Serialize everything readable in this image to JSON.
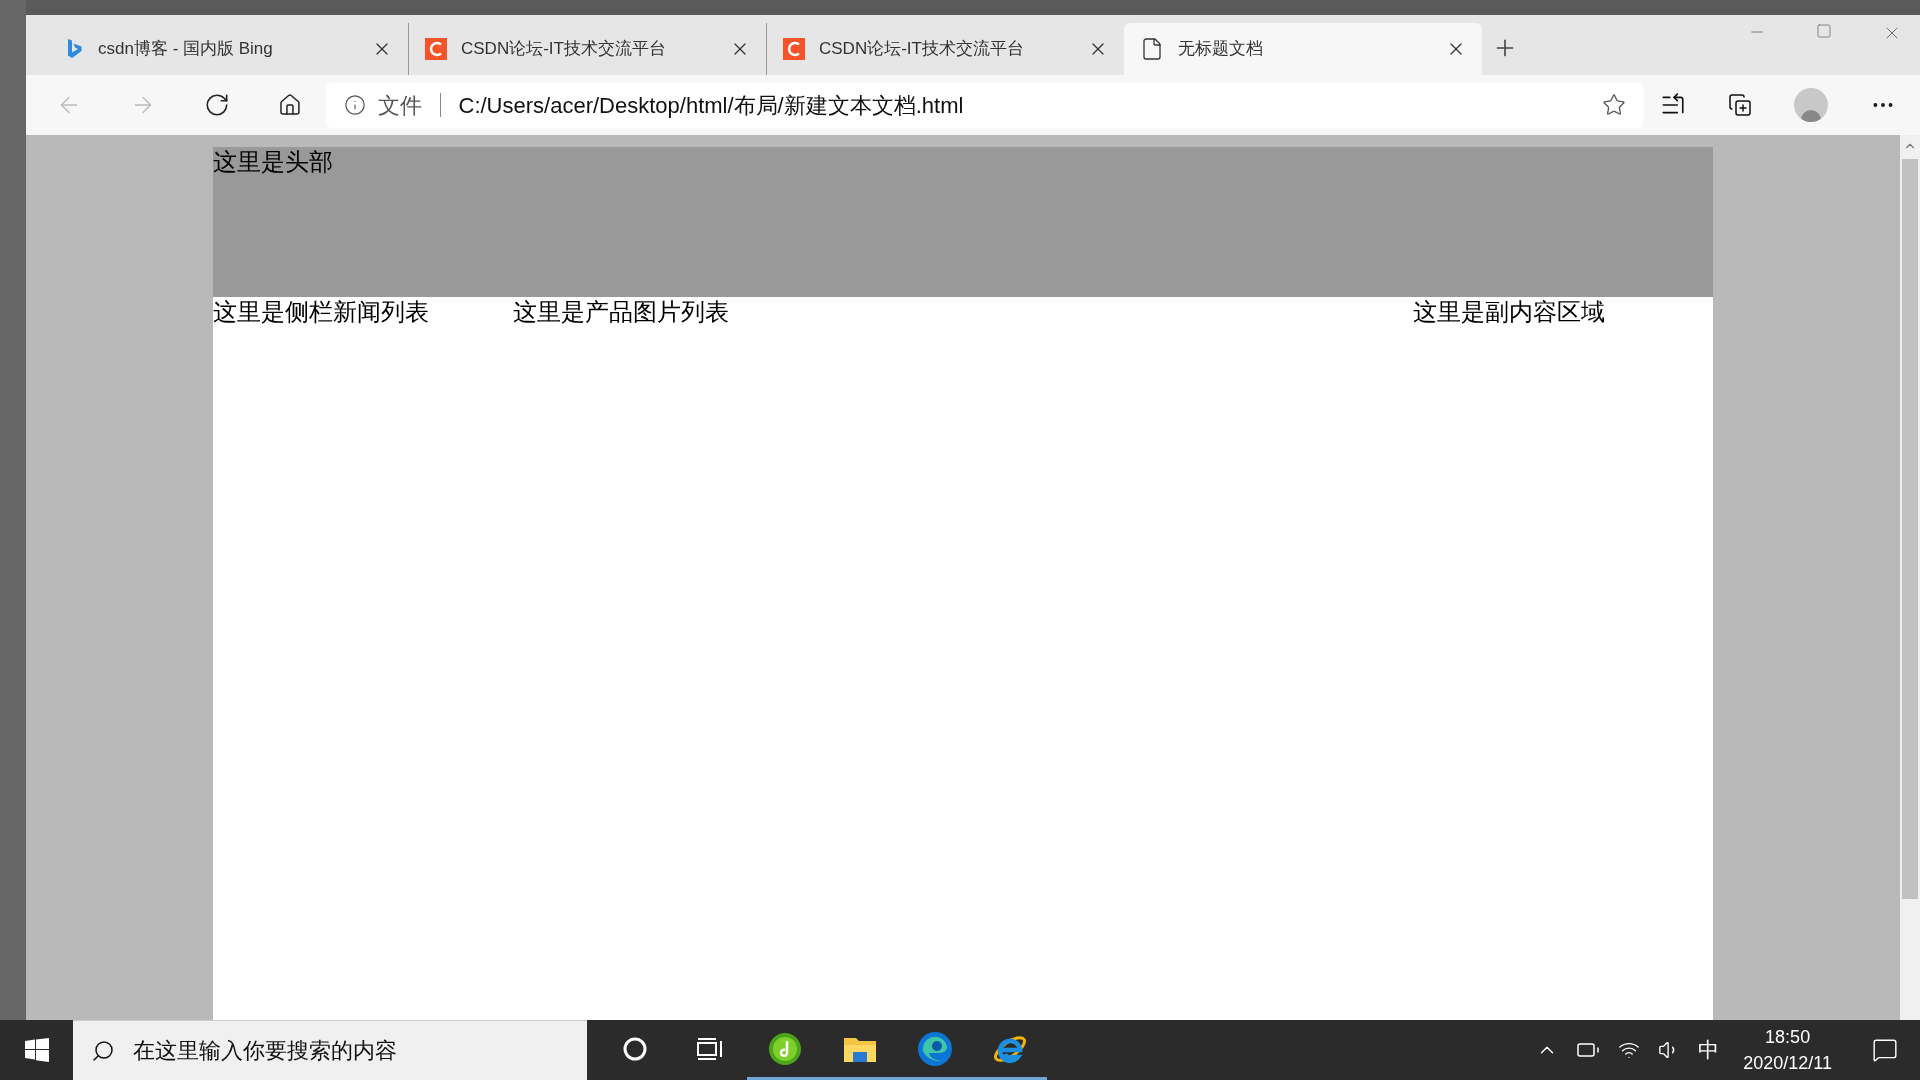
{
  "browser": {
    "tabs": [
      {
        "kind": "bing",
        "title": "csdn博客 - 国内版 Bing",
        "selected": false
      },
      {
        "kind": "csdn",
        "title": "CSDN论坛-IT技术交流平台",
        "selected": false
      },
      {
        "kind": "csdn",
        "title": "CSDN论坛-IT技术交流平台",
        "selected": false
      },
      {
        "kind": "file",
        "title": "无标题文档",
        "selected": true
      }
    ],
    "address_bar": {
      "scheme_label": "文件",
      "url": "C:/Users/acer/Desktop/html/布局/新建文本文档.html"
    }
  },
  "page": {
    "header": "这里是头部",
    "sidebar": "这里是侧栏新闻列表",
    "main": "这里是产品图片列表",
    "aside": "这里是副内容区域"
  },
  "taskbar": {
    "search": {
      "placeholder": "在这里输入你要搜索的内容"
    },
    "apps": [
      {
        "kind": "cortana",
        "open": false
      },
      {
        "kind": "task-view",
        "open": false
      },
      {
        "kind": "music",
        "open": true
      },
      {
        "kind": "explorer",
        "open": true
      },
      {
        "kind": "edge",
        "open": true
      },
      {
        "kind": "ie",
        "open": true
      }
    ],
    "input_method": "中",
    "time": "18:50",
    "date": "2020/12/11"
  }
}
